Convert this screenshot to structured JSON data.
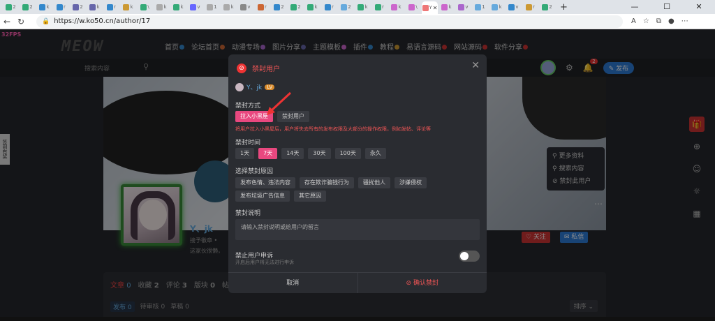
{
  "browser": {
    "tab_count_icons": [
      "#3a7",
      "#3a7",
      "#38c",
      "#38c",
      "#66a",
      "#66a",
      "#38c",
      "#c93",
      "#3a7",
      "#aaa",
      "#3a7",
      "#66f",
      "#aaa",
      "#aaa",
      "#888",
      "#c63",
      "#38c",
      "#3a7",
      "#3a7",
      "#38c",
      "#6ad",
      "#3a7",
      "#3a7",
      "#c6c",
      "#c6c",
      "#e77",
      "#c6c",
      "#a6c",
      "#6ad",
      "#6ad",
      "#38c",
      "#c93",
      "#3a7"
    ],
    "tab_label_cut": [
      "2",
      "2",
      "k",
      "r",
      "2",
      "k",
      "r",
      "k",
      "\\",
      "k",
      "k",
      "v",
      "1",
      "k",
      "v",
      "r"
    ],
    "active_tab_letter": "Y",
    "new_tab": "+",
    "url": "https://w.ko50.cn/author/17",
    "minimize": "—",
    "maximize": "☐",
    "close": "✕"
  },
  "site": {
    "fps": "32FPS",
    "logo": "MEOW",
    "nav": [
      {
        "label": "首页",
        "color": "#38c"
      },
      {
        "label": "论坛首页",
        "color": "#c63"
      },
      {
        "label": "动漫专场",
        "color": "#a6c"
      },
      {
        "label": "图片分享",
        "color": "#66a"
      },
      {
        "label": "主题模板",
        "color": "#c6c"
      },
      {
        "label": "插件",
        "color": "#38c"
      },
      {
        "label": "教程",
        "color": "#c93"
      },
      {
        "label": "易语言源码",
        "color": "#c33"
      },
      {
        "label": "网站源码",
        "color": "#c33"
      },
      {
        "label": "软件分享",
        "color": "#c33"
      }
    ],
    "search_placeholder": "搜索内容",
    "notif_count": "2",
    "post_button": "✎ 发布",
    "left_tab": "签到有奖",
    "profile_menu": [
      "更多资料",
      "搜索内容",
      "禁封此用户"
    ],
    "username": "Y、jk",
    "user_sub": "接予徽章 •",
    "user_bio": "这家伙很懒，",
    "follow": "♡ 关注",
    "message": "✉ 私信",
    "content_tabs": [
      {
        "label": "文章",
        "count": "0"
      },
      {
        "label": "收藏",
        "count": "2"
      },
      {
        "label": "评论",
        "count": "3"
      },
      {
        "label": "版块",
        "count": "0"
      },
      {
        "label": "帖",
        "count": ""
      }
    ],
    "sub_tabs": [
      {
        "label": "发布",
        "count": "0"
      },
      {
        "label": "待审核",
        "count": "0"
      },
      {
        "label": "草稿",
        "count": "0"
      }
    ],
    "sort": "排序 ⌄"
  },
  "modal": {
    "title": "禁封用户",
    "user": "Y、jk",
    "level": "LV",
    "method_label": "禁封方式",
    "methods": [
      "拉入小黑屋",
      "禁封用户"
    ],
    "warning": "将用户拉入小黑屋后，用户将失去所有的发布权限及大部分的操作权限，例如发帖、评论等",
    "duration_label": "禁封时间",
    "durations": [
      "1天",
      "7天",
      "14天",
      "30天",
      "100天",
      "永久"
    ],
    "selected_duration": "7天",
    "reason_label": "选择禁封原因",
    "reasons": [
      "发布色情、违法内容",
      "存在欺诈骗钱行为",
      "骚扰他人",
      "涉嫌侵权",
      "发布垃圾广告信息",
      "其它原因"
    ],
    "note_label": "禁封说明",
    "note_placeholder": "请输入禁封说明或给用户的留言",
    "appeal_label": "禁止用户申诉",
    "appeal_sub": "开启后用户将无法进行申诉",
    "appeal_enabled": false,
    "cancel": "取消",
    "confirm": "⊘ 确认禁封"
  }
}
